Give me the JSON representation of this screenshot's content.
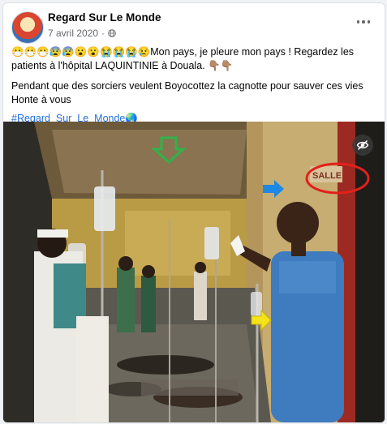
{
  "post": {
    "page_name": "Regard Sur Le Monde",
    "date": "7 avril 2020",
    "separator": "·",
    "paragraph1": "😷😷😷😰😰😮😮😭😭😭😢Mon pays, je pleure mon pays ! Regardez les patients à l'hôpital LAQUINTINIE à Douala. 👇🏽👇🏽",
    "paragraph2_line1": "Pendant que des sorciers veulent Boyocottez la cagnotte pour sauver ces vies",
    "paragraph2_line2": "Honte à vous",
    "hashtag": "#Regard_Sur_Le_Monde🌏",
    "photo_sign_text": "SALLE"
  },
  "icons": {
    "privacy": "globe-icon",
    "menu": "more-horizontal-icon",
    "hide": "eye-slash-icon"
  },
  "colors": {
    "link": "#216fdb",
    "arrow_green": "#2fb34a",
    "arrow_blue": "#1e88e5",
    "arrow_yellow": "#f4e21a",
    "circle_red": "#e3201b"
  }
}
